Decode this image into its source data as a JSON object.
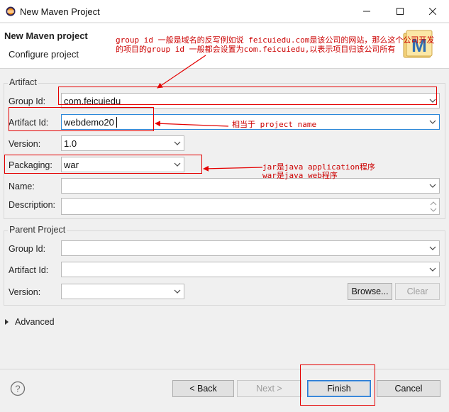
{
  "window": {
    "title": "New Maven Project",
    "icon": "eclipse-icon",
    "controls": [
      "minimize-icon",
      "maximize-icon",
      "close-icon"
    ]
  },
  "header": {
    "title": "New Maven project",
    "subtitle": "Configure project",
    "logo_letter": "M"
  },
  "artifact": {
    "group_title": "Artifact",
    "group_id_label": "Group Id:",
    "group_id_value": "com.feicuiedu",
    "artifact_id_label": "Artifact Id:",
    "artifact_id_value": "webdemo20",
    "version_label": "Version:",
    "version_value": "1.0",
    "packaging_label": "Packaging:",
    "packaging_value": "war",
    "name_label": "Name:",
    "name_value": "",
    "description_label": "Description:",
    "description_value": ""
  },
  "parent": {
    "group_title": "Parent Project",
    "group_id_label": "Group Id:",
    "artifact_id_label": "Artifact Id:",
    "version_label": "Version:",
    "browse_label": "Browse...",
    "clear_label": "Clear"
  },
  "advanced": {
    "label": "Advanced"
  },
  "footer": {
    "help_symbol": "?",
    "back_label": "< Back",
    "next_label": "Next >",
    "finish_label": "Finish",
    "cancel_label": "Cancel"
  },
  "annotations": {
    "group_note_line1": "group id 一般是域名的反写例如说 feicuiedu.com是该公司的网站，那么这个公司开发",
    "group_note_line2": "的项目的group id 一般都会设置为com.feicuiedu,以表示项目归该公司所有",
    "artifact_note": "相当于 project name",
    "packaging_note_line1": "jar是java application程序",
    "packaging_note_line2": "war是java web程序"
  },
  "colors": {
    "annotation_red": "#e40000",
    "focus_blue": "#2c88d9",
    "maven_blue": "#2f6fb5"
  }
}
